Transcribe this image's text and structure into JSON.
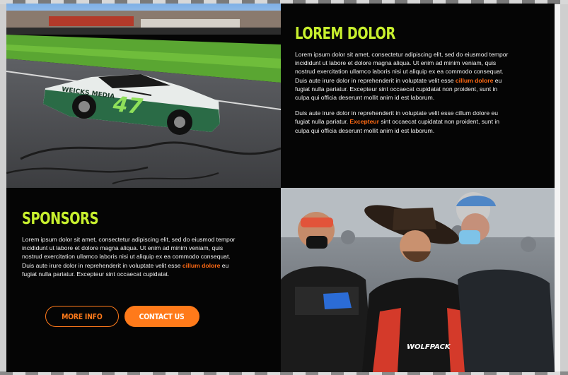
{
  "colors": {
    "heading_lime": "#c8f02e",
    "accent_orange": "#ff6a14",
    "button_orange": "#ff7a1a",
    "panel_bg": "#050505"
  },
  "section_top": {
    "heading": "LOREM DOLOR",
    "p1_a": "Lorem ipsum dolor sit amet, consectetur adipiscing elit, sed do eiusmod tempor incididunt ut labore et dolore magna aliqua. Ut enim ad minim veniam, quis nostrud exercitation ullamco laboris nisi ut aliquip ex ea commodo consequat. Duis aute irure dolor in reprehenderit in voluptate velit esse ",
    "p1_hl": "cillum dolore",
    "p1_b": " eu fugiat nulla pariatur. Excepteur sint occaecat cupidatat non proident, sunt in culpa qui officia deserunt mollit anim id est laborum.",
    "p2_a": "Duis aute irure dolor in reprehenderit in voluptate velit esse cillum dolore eu fugiat nulla pariatur. ",
    "p2_hl": "Excepteur",
    "p2_b": " sint occaecat cupidatat non proident, sunt in culpa qui officia deserunt mollit anim id est laborum."
  },
  "section_sponsors": {
    "heading": "SPONSORS",
    "p1_a": "Lorem ipsum dolor sit amet, consectetur adipiscing elit, sed do eiusmod tempor incididunt ut labore et dolore magna aliqua. Ut enim ad minim veniam, quis nostrud exercitation ullamco laboris nisi ut aliquip ex ea commodo consequat. Duis aute irure dolor in reprehenderit in voluptate velit esse ",
    "p1_hl": "cillum dolore",
    "p1_b": " eu fugiat nulla pariatur. Excepteur sint occaecat cupidatat."
  },
  "buttons": {
    "more_info": "MORE INFO",
    "contact_us": "CONTACT US"
  },
  "photos": {
    "race_car_sponsor": "WEICKS MEDIA",
    "race_car_number": "47",
    "crew_jacket_text": "WOLFPACK"
  }
}
